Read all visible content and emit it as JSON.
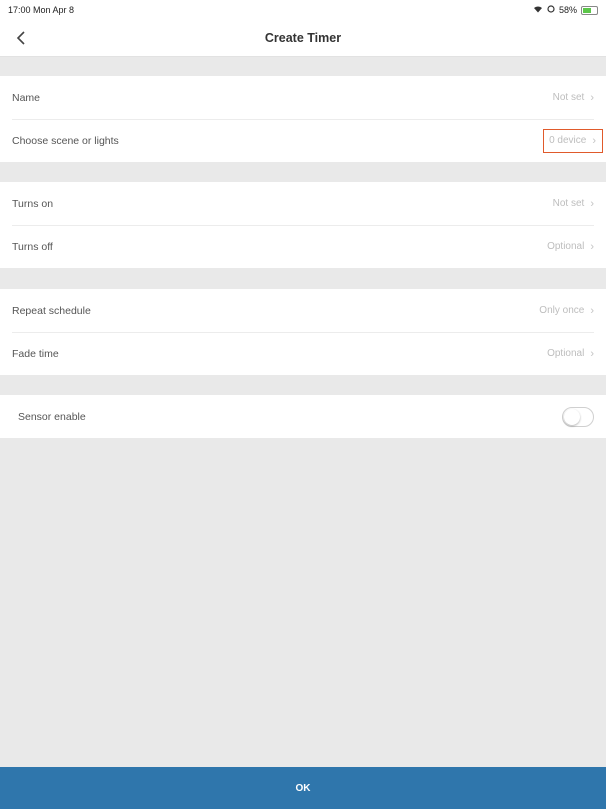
{
  "status": {
    "time": "17:00  Mon Apr 8",
    "battery": "58%"
  },
  "nav": {
    "title": "Create Timer"
  },
  "group1": {
    "name_label": "Name",
    "name_value": "Not set",
    "scene_label": "Choose scene or lights",
    "scene_value": "0 device"
  },
  "group2": {
    "on_label": "Turns on",
    "on_value": "Not set",
    "off_label": "Turns off",
    "off_value": "Optional"
  },
  "group3": {
    "repeat_label": "Repeat schedule",
    "repeat_value": "Only once",
    "fade_label": "Fade time",
    "fade_value": "Optional"
  },
  "group4": {
    "sensor_label": "Sensor enable",
    "sensor_enabled": false
  },
  "footer": {
    "ok_label": "OK"
  },
  "colors": {
    "accent": "#2f76ac",
    "highlight": "#e05a2b",
    "background": "#e9e9e9"
  }
}
